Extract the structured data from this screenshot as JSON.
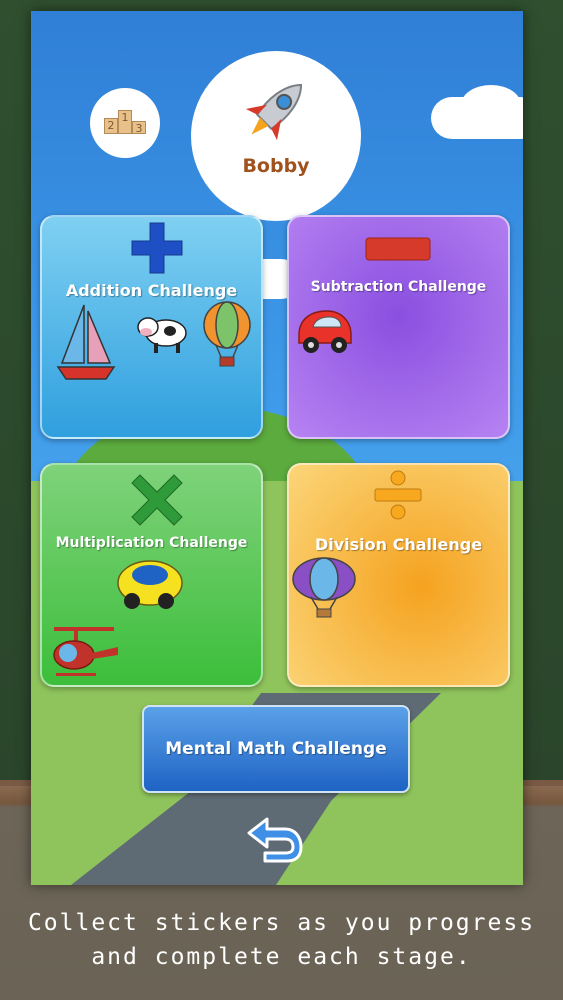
{
  "player": {
    "name": "Bobby"
  },
  "podium": {
    "first": "1",
    "second": "2",
    "third": "3"
  },
  "challenges": {
    "addition": "Addition Challenge",
    "subtraction": "Subtraction Challenge",
    "multiplication": "Multiplication Challenge",
    "division": "Division Challenge",
    "mental": "Mental Math Challenge"
  },
  "icons": {
    "award": "podium-icon",
    "avatar": "rocket-icon",
    "back": "back-arrow-icon",
    "addition": "plus-icon",
    "subtraction": "minus-icon",
    "multiplication": "multiply-icon",
    "division": "divide-icon"
  },
  "caption": {
    "line1": "Collect stickers as you progress",
    "line2": "and complete each stage."
  },
  "colors": {
    "addition": "#2f9fde",
    "subtraction": "#8a4fe0",
    "multiplication": "#3cbe3b",
    "division": "#f5a21f",
    "mental": "#1f63c4",
    "name": "#a0521e"
  }
}
